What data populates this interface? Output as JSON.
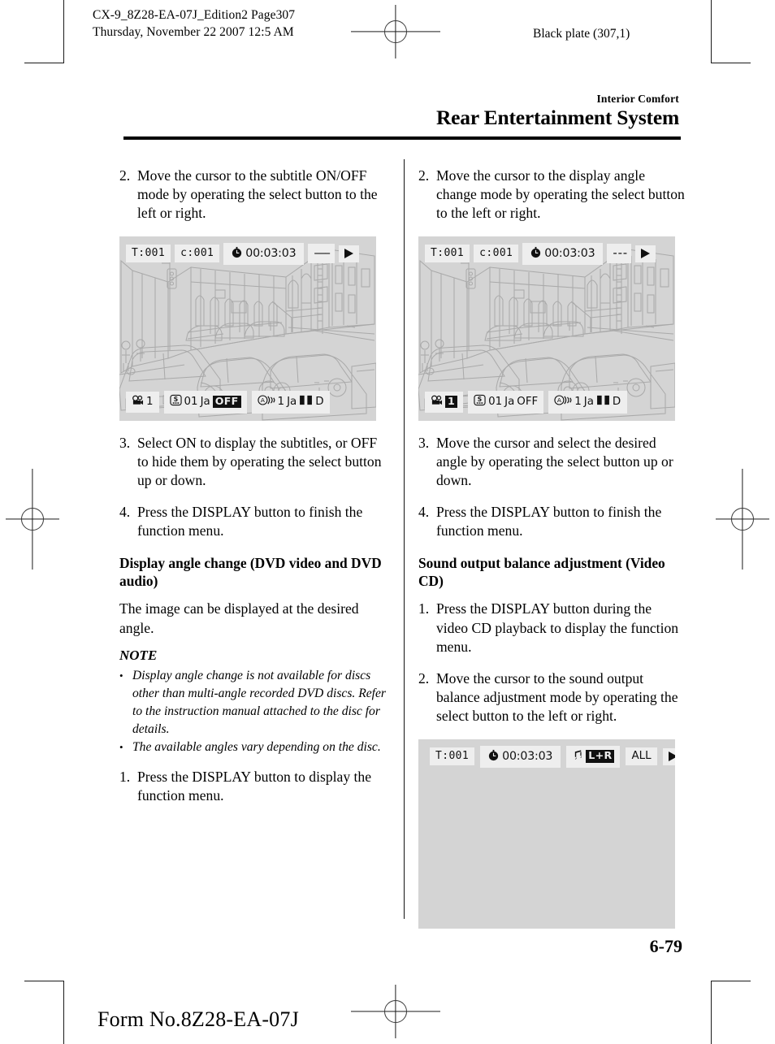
{
  "print_header": {
    "line1": "CX-9_8Z28-EA-07J_Edition2 Page307",
    "line2": "Thursday, November 22 2007 12:5 AM",
    "black_plate": "Black plate (307,1)"
  },
  "section": {
    "supertitle": "Interior Comfort",
    "title": "Rear Entertainment System"
  },
  "left_column": {
    "step2": {
      "num": "2.",
      "text": "Move the cursor to the subtitle ON/OFF mode by operating the select button to the left or right."
    },
    "screen": {
      "top_bar": {
        "title_label": "T:001",
        "chapter_label": "c:001",
        "clock_icon": "clock-icon",
        "time": "00:03:03",
        "repeat": "—–",
        "play_icon": "play-icon"
      },
      "bottom_bar": {
        "angle_icon": "movie-camera-icon",
        "angle_value": "1",
        "angle_highlighted": false,
        "subtitle_icon": "subtitle-s-icon",
        "subtitle_number": "01",
        "subtitle_language": "Ja",
        "subtitle_state": "OFF",
        "subtitle_highlighted": true,
        "audio_icon": "audio-waves-icon",
        "audio_number": "1",
        "audio_language": "Ja",
        "audio_format": "D",
        "audio_format_icon": "dolby-digital-icon"
      }
    },
    "step3": {
      "num": "3.",
      "text": "Select ON to display the subtitles, or OFF to hide them by operating the select button up or down."
    },
    "step4": {
      "num": "4.",
      "text": "Press the DISPLAY button to finish the function menu."
    },
    "heading": "Display angle change (DVD video and DVD audio)",
    "paragraph": "The image can be displayed at the desired angle.",
    "note_label": "NOTE",
    "notes": [
      "Display angle change is not available for discs other than multi-angle recorded DVD discs. Refer to the instruction manual attached to the disc for details.",
      "The available angles vary depending on the disc."
    ],
    "bullet": "•",
    "step1": {
      "num": "1.",
      "text": "Press the DISPLAY button to display the function menu."
    }
  },
  "right_column": {
    "step2": {
      "num": "2.",
      "text": "Move the cursor to the display angle change mode by operating the select button to the left or right."
    },
    "screen": {
      "top_bar": {
        "title_label": "T:001",
        "chapter_label": "c:001",
        "clock_icon": "clock-icon",
        "time": "00:03:03",
        "repeat": "- - -",
        "play_icon": "play-icon"
      },
      "bottom_bar": {
        "angle_icon": "movie-camera-icon",
        "angle_value": "1",
        "angle_highlighted": true,
        "subtitle_icon": "subtitle-s-icon",
        "subtitle_number": "01",
        "subtitle_language": "Ja",
        "subtitle_state": "OFF",
        "subtitle_highlighted": false,
        "audio_icon": "audio-waves-icon",
        "audio_number": "1",
        "audio_language": "Ja",
        "audio_format": "D",
        "audio_format_icon": "dolby-digital-icon"
      }
    },
    "step3": {
      "num": "3.",
      "text": "Move the cursor and select the desired angle by operating the select button up or down."
    },
    "step4": {
      "num": "4.",
      "text": "Press the DISPLAY button to finish the function menu."
    },
    "heading": "Sound output balance adjustment (Video CD)",
    "step1": {
      "num": "1.",
      "text": "Press the DISPLAY button during the video CD playback to display the function menu."
    },
    "step2b": {
      "num": "2.",
      "text": "Move the cursor to the sound output balance adjustment mode by operating the select button to the left or right."
    },
    "screen_vcd": {
      "top_bar": {
        "title_label": "T:001",
        "clock_icon": "clock-icon",
        "time": "00:03:03",
        "music_icon": "music-note-icon",
        "balance": "L+R",
        "balance_highlighted": true,
        "repeat_mode": "ALL",
        "play_icon": "play-icon"
      }
    }
  },
  "footer": {
    "page_number": "6-79",
    "form_number": "Form No.8Z28-EA-07J"
  },
  "colors": {
    "screen_bg": "#d4d4d4",
    "chip_bg": "#eeeeee",
    "highlight_bg": "#111111",
    "ink": "#000000",
    "art_line": "#a9a9a9"
  }
}
